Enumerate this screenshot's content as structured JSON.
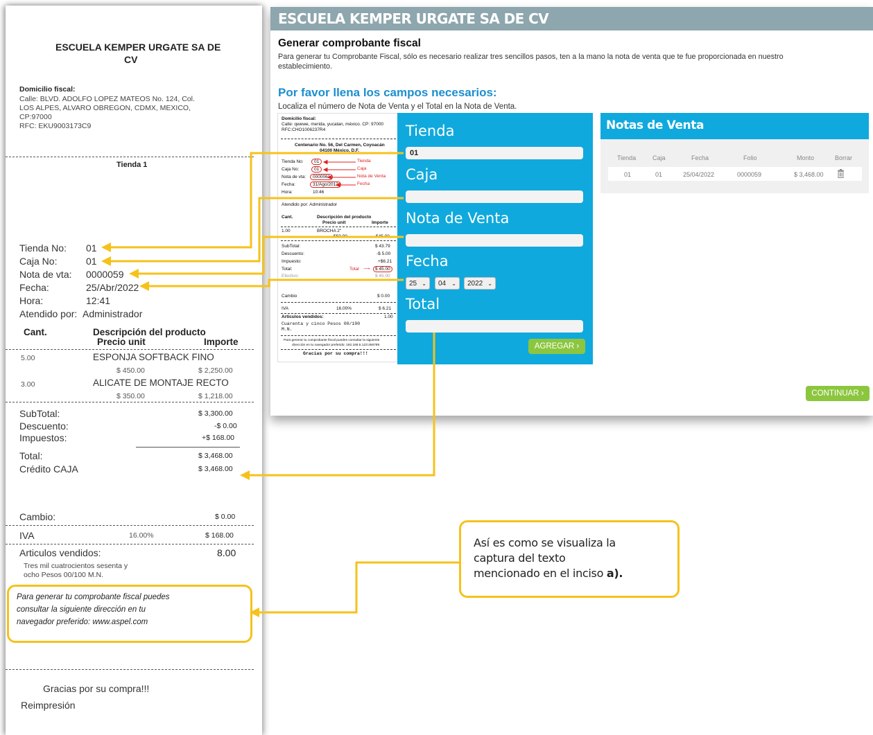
{
  "receipt": {
    "company": "ESCUELA KEMPER URGATE SA DE CV",
    "company_line1": "ESCUELA KEMPER URGATE SA DE",
    "company_line2": "CV",
    "domicilio_label": "Domicilio fiscal:",
    "address_line1": "Calle: BLVD. ADOLFO LOPEZ MATEOS No. 124, Col.",
    "address_line2": "LOS ALPES, ALVARO OBREGON, CDMX, MEXICO,",
    "address_line3": "CP:97000",
    "rfc": "RFC: EKU9003173C9",
    "tienda_title": "Tienda 1",
    "tienda_label": "Tienda No:",
    "tienda_value": "01",
    "caja_label": "Caja No:",
    "caja_value": "01",
    "nota_label": "Nota de vta:",
    "nota_value": "0000059",
    "fecha_label": "Fecha:",
    "fecha_value": "25/Abr/2022",
    "hora_label": "Hora:",
    "hora_value": "12:41",
    "atendido_label": "Atendido por:",
    "atendido_value": "Administrador",
    "col_cant": "Cant.",
    "col_desc": "Descripción del producto",
    "col_precio": "Precio unit",
    "col_importe": "Importe",
    "items": [
      {
        "cant": "5.00",
        "desc": "ESPONJA SOFTBACK FINO",
        "precio": "$ 450.00",
        "importe": "$ 2,250.00"
      },
      {
        "cant": "3.00",
        "desc": "ALICATE DE MONTAJE RECTO",
        "precio": "$ 350.00",
        "importe": "$ 1,218.00"
      }
    ],
    "subtotal_label": "SubTotal:",
    "subtotal_value": "$ 3,300.00",
    "descuento_label": "Descuento:",
    "descuento_value": "-$ 0.00",
    "impuestos_label": "Impuestos:",
    "impuestos_value": "+$ 168.00",
    "total_label": "Total:",
    "total_value": "$ 3,468.00",
    "credito_label": "Crédito CAJA",
    "credito_value": "$ 3,468.00",
    "cambio_label": "Cambio:",
    "cambio_value": "$ 0.00",
    "iva_label": "IVA",
    "iva_pct": "16.00%",
    "iva_value": "$ 168.00",
    "articulos_label": "Articulos vendidos:",
    "articulos_value": "8.00",
    "letra_line1": "Tres mil cuatrocientos sesenta y",
    "letra_line2": "ocho Pesos 00/100 M.N.",
    "portal_line1": "Para generar tu comprobante fiscal puedes",
    "portal_line2": "consultar la siguiente dirección en tu",
    "portal_line3": "navegador preferido: www.aspel.com",
    "gracias": "Gracias por su compra!!!",
    "reimpresion": "Reimpresión"
  },
  "web": {
    "header_title": "ESCUELA KEMPER URGATE SA DE CV",
    "heading": "Generar comprobante fiscal",
    "intro_line1": "Para generar tu Comprobante Fiscal, sólo es necesario realizar tres sencillos pasos, ten a la mano la nota de venta que te fue proporcionada en nuestro",
    "intro_line2": "establecimiento.",
    "subheading": "Por favor llena los campos necesarios:",
    "instruction": "Localiza el número de Nota de Venta y el Total en la Nota de Venta.",
    "form": {
      "tienda_label": "Tienda",
      "tienda_value": "01",
      "caja_label": "Caja",
      "caja_value": "",
      "nota_label": "Nota de Venta",
      "nota_value": "",
      "fecha_label": "Fecha",
      "day": "25",
      "month": "04",
      "year": "2022",
      "total_label": "Total",
      "total_value": "",
      "agregar": "AGREGAR"
    },
    "notas": {
      "title": "Notas de Venta",
      "headers": [
        "Tienda",
        "Caja",
        "Fecha",
        "Folio",
        "Monto",
        "Borrar"
      ],
      "row": {
        "tienda": "01",
        "caja": "01",
        "fecha": "25/04/2022",
        "folio": "0000059",
        "monto": "$ 3,468.00"
      }
    },
    "continuar": "CONTINUAR",
    "mini_receipt": {
      "domicilio": "Domicilio fiscal:",
      "addr": "Calle: qwewe, merida, yucatan, méxico. CP: 97000",
      "rfc": "RFC:CHO1006237R4",
      "center1": "Centenario No. 56, Del Carmen, Coyoacán",
      "center2": "04100 México, D.F.",
      "tienda": "Tienda No:",
      "tienda_v": "01",
      "tienda_tag": "Tienda",
      "caja": "Caja No:",
      "caja_v": "01",
      "caja_tag": "Caja",
      "nota": "Nota de vta:",
      "nota_v": "0000061",
      "nota_tag": "Nota de Venta",
      "fecha": "Fecha:",
      "fecha_v": "31/Ago/2012",
      "fecha_tag": "Fecha",
      "hora": "Hora:",
      "hora_v": "10:46",
      "atendido": "Atendido por: Administrador",
      "cant": "Cant.",
      "desc": "Descripción del producto",
      "precio": "Precio unit",
      "importe": "Importe",
      "item_cant": "1.00",
      "item_desc": "BROCHA 2\"",
      "item_p": "$50.00",
      "item_i": "$45.00",
      "subtotal": "SubTotal:",
      "subtotal_v": "$ 43.79",
      "descuento": "Descuento:",
      "descuento_v": "-$ 5.00",
      "impuesto": "Impuesto:",
      "impuesto_v": "+$6.21",
      "total": "Total:",
      "total_tag": "Total",
      "total_v": "$ 45.00",
      "efectivo": "Efectivo:",
      "efectivo_v": "$ 45.00",
      "cambio": "Cambio",
      "cambio_v": "$ 0.00",
      "iva": "IVA",
      "iva_pct": "16.00%",
      "iva_v": "$ 6.21",
      "articulos": "Articulos vendidos:",
      "articulos_v": "1.00",
      "letra1": "Cuarenta y cinco Pesos 00/100",
      "letra2": "M.N.",
      "portal1": "Para generar tu comprobante fiscal puedes consultar la siguiente",
      "portal2": "dirección en tu navegador preferido: 192.168.5.123:456789",
      "gracias": "Gracias por su compra!!!"
    }
  },
  "callout": {
    "line1": "Así es como se visualiza la",
    "line2": "captura del texto",
    "line3": "mencionado en el inciso",
    "bold": "a)."
  },
  "colors": {
    "accent_blue": "#10a9dd",
    "header_gray": "#8ea6ad",
    "heading_blue": "#1a8fd0",
    "button_green": "#8cc63f",
    "arrow_yellow": "#f5c21b",
    "label_red": "#e02020"
  }
}
